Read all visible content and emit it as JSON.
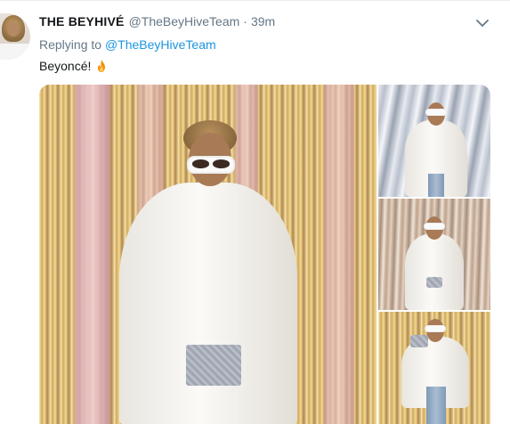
{
  "tweet": {
    "display_name": "THE BEYHIVÉ",
    "handle": "@TheBeyHiveTeam",
    "separator": "·",
    "time": "39m",
    "replying_prefix": "Replying to",
    "replying_to": "@TheBeyHiveTeam",
    "text": "Beyoncé!",
    "emoji_icon": "fire-icon"
  },
  "colors": {
    "link": "#1b95e0",
    "secondary_text": "#657786",
    "primary_text": "#14171a"
  },
  "media": {
    "photo_count": 4
  }
}
